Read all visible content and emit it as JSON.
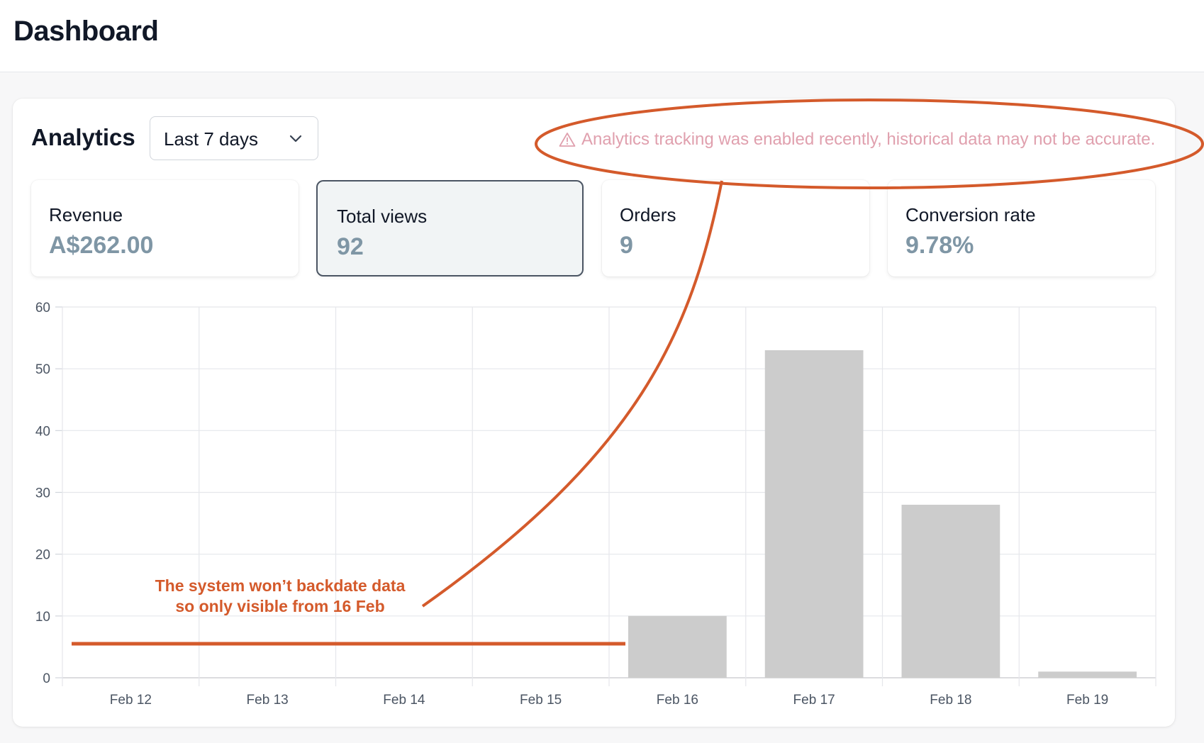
{
  "header": {
    "title": "Dashboard"
  },
  "analytics": {
    "title": "Analytics",
    "period": {
      "selected": "Last 7 days"
    },
    "warning": "Analytics tracking was enabled recently, historical data may not be accurate."
  },
  "stats": [
    {
      "label": "Revenue",
      "value": "A$262.00"
    },
    {
      "label": "Total views",
      "value": "92",
      "selected": true
    },
    {
      "label": "Orders",
      "value": "9"
    },
    {
      "label": "Conversion rate",
      "value": "9.78%"
    }
  ],
  "annotation": {
    "line1": "The system won’t backdate data",
    "line2": "so only visible from 16 Feb"
  },
  "colors": {
    "accent_value": "#7f96a5",
    "warning_text": "#e0a0ae",
    "annotation": "#d45a2b",
    "bar": "#cccccc"
  },
  "chart_data": {
    "type": "bar",
    "categories": [
      "Feb 12",
      "Feb 13",
      "Feb 14",
      "Feb 15",
      "Feb 16",
      "Feb 17",
      "Feb 18",
      "Feb 19"
    ],
    "values": [
      0,
      0,
      0,
      0,
      10,
      53,
      28,
      1
    ],
    "ylim": [
      0,
      60
    ],
    "yticks": [
      0,
      10,
      20,
      30,
      40,
      50,
      60
    ],
    "grid": true,
    "legend": "none"
  }
}
